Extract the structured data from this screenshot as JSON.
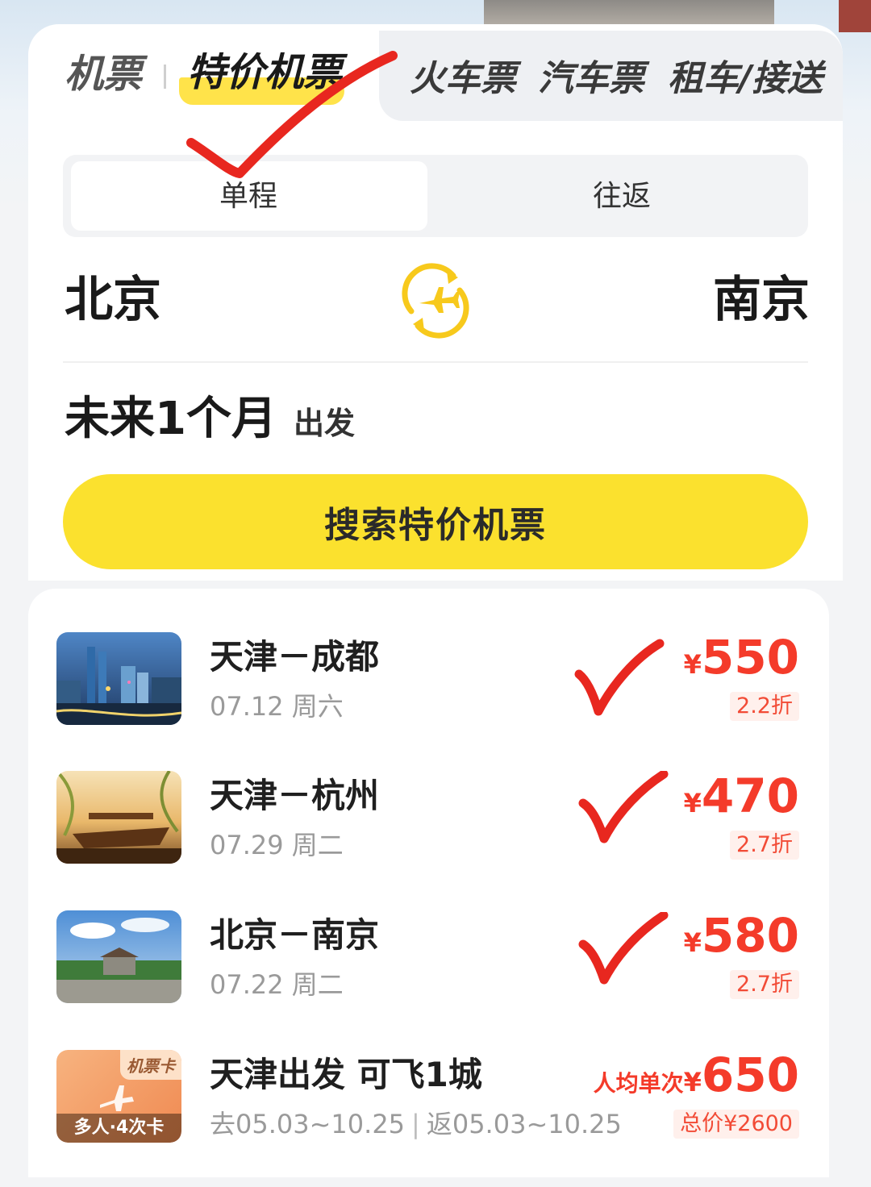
{
  "colors": {
    "accent_yellow": "#fbe12e",
    "price_red": "#f43b2a",
    "annotation_red": "#e8271f"
  },
  "tabs": {
    "flight": "机票",
    "special": "特价机票",
    "train": "火车票",
    "bus": "汽车票",
    "car": "租车/接送"
  },
  "trip_type": {
    "one_way": "单程",
    "round_trip": "往返",
    "selected": "单程"
  },
  "route": {
    "from": "北京",
    "to": "南京",
    "swap_icon": "plane-swap-icon"
  },
  "date": {
    "range": "未来1个月",
    "suffix": "出发"
  },
  "search_button": "搜索特价机票",
  "deals": [
    {
      "route": "天津－成都",
      "date": "07.12 周六",
      "currency": "¥",
      "price": "550",
      "discount": "2.2折",
      "image": "chengdu-city-photo"
    },
    {
      "route": "天津－杭州",
      "date": "07.29 周二",
      "currency": "¥",
      "price": "470",
      "discount": "2.7折",
      "image": "hangzhou-lake-photo"
    },
    {
      "route": "北京－南京",
      "date": "07.22 周二",
      "currency": "¥",
      "price": "580",
      "discount": "2.7折",
      "image": "nanjing-landmark-photo"
    }
  ],
  "pass": {
    "badge_tag": "机票卡",
    "badge_foot": "多人·4次卡",
    "title": "天津出发 可飞1城",
    "dates_out": "去05.03~10.25",
    "dates_sep": "|",
    "dates_back": "返05.03~10.25",
    "price_prefix": "人均单次",
    "currency": "¥",
    "price": "650",
    "total": "总价¥2600"
  }
}
